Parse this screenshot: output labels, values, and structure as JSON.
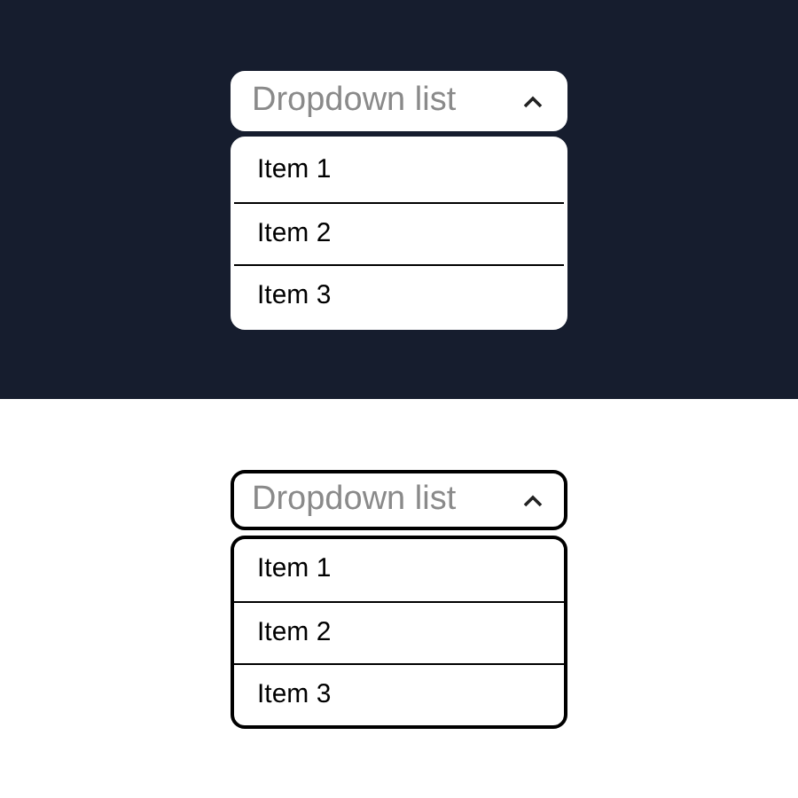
{
  "panels": [
    {
      "dark": true,
      "dropdown": {
        "label": "Dropdown list",
        "expanded": true,
        "items": [
          "Item 1",
          "Item 2",
          "Item 3"
        ]
      }
    },
    {
      "dark": false,
      "dropdown": {
        "label": "Dropdown list",
        "expanded": true,
        "items": [
          "Item 1",
          "Item 2",
          "Item 3"
        ]
      }
    }
  ]
}
